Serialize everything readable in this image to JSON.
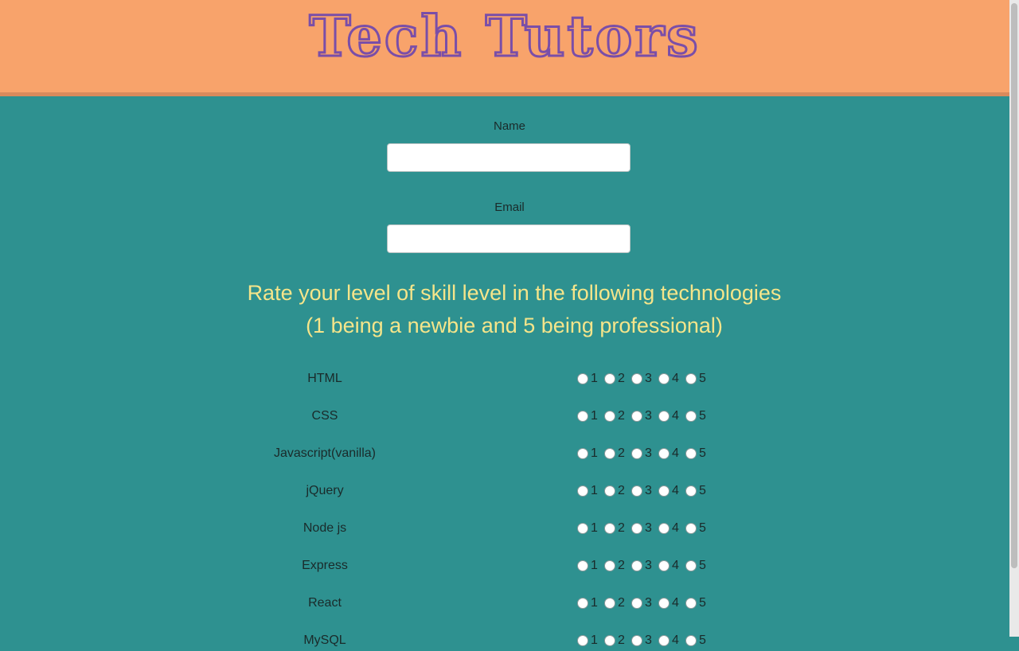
{
  "header": {
    "brand": "Tech Tutors"
  },
  "form": {
    "name_label": "Name",
    "name_value": "",
    "email_label": "Email",
    "email_value": ""
  },
  "instructions": {
    "line1": "Rate your level of skill level in the following technologies",
    "line2": "(1 being a newbie and 5 being professional)"
  },
  "rating_options": [
    "1",
    "2",
    "3",
    "4",
    "5"
  ],
  "technologies": [
    "HTML",
    "CSS",
    "Javascript(vanilla)",
    "jQuery",
    "Node js",
    "Express",
    "React",
    "MySQL"
  ],
  "colors": {
    "header_bg": "#f8a36b",
    "page_bg": "#2e9190",
    "brand": "#7a4ea8",
    "instructions": "#f5e58a"
  }
}
